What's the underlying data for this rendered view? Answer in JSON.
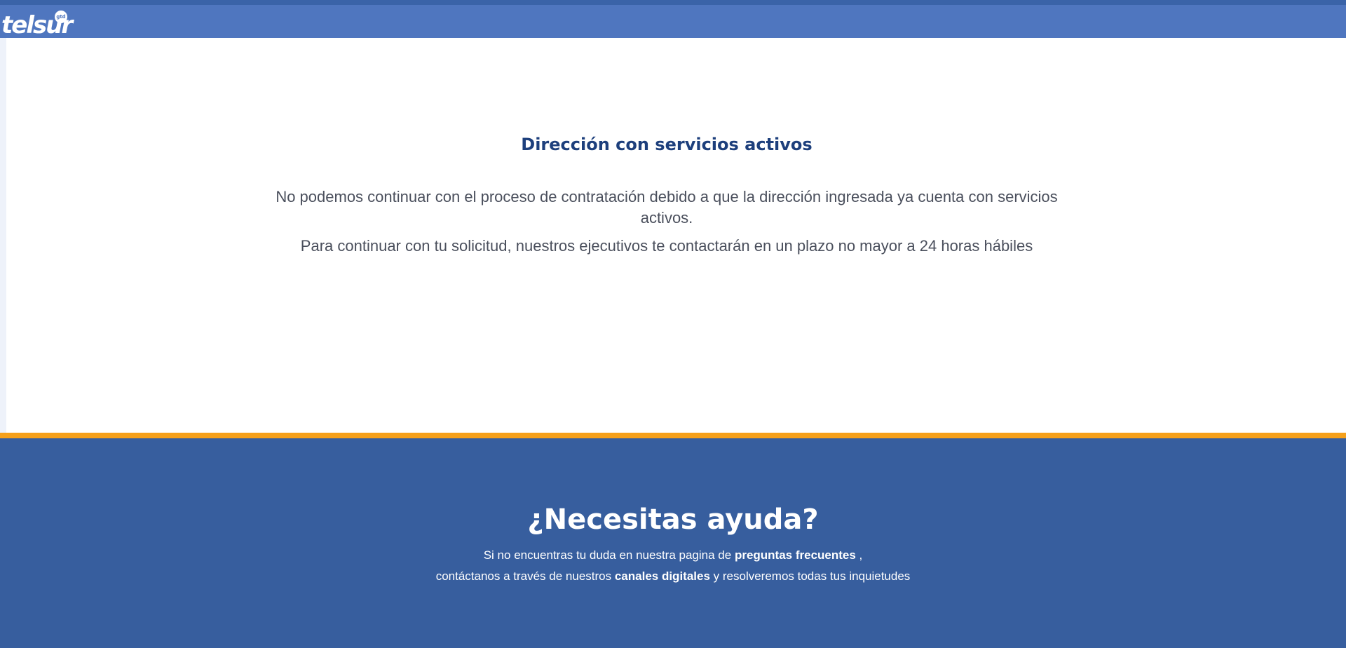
{
  "header": {
    "logo_text": "telsur",
    "logo_badge": "gtd"
  },
  "message": {
    "title": "Dirección con servicios activos",
    "paragraph1": "No podemos continuar con el proceso de contratación debido a que la dirección ingresada ya cuenta con servicios activos.",
    "paragraph2": "Para continuar con tu solicitud, nuestros ejecutivos te contactarán en un plazo no mayor a 24 horas hábiles"
  },
  "footer": {
    "title": "¿Necesitas ayuda?",
    "line1_prefix": "Si no encuentras tu duda en nuestra pagina de ",
    "faq_link": "preguntas frecuentes",
    "line1_suffix": " ,",
    "line2_prefix": "contáctanos a través de nuestros ",
    "channels_link": "canales digitales",
    "line2_suffix": " y resolveremos todas tus inquietudes"
  },
  "colors": {
    "header_bg": "#4f76bf",
    "footer_bg": "#375e9e",
    "accent": "#f5a01a",
    "title": "#1d3f7c"
  }
}
